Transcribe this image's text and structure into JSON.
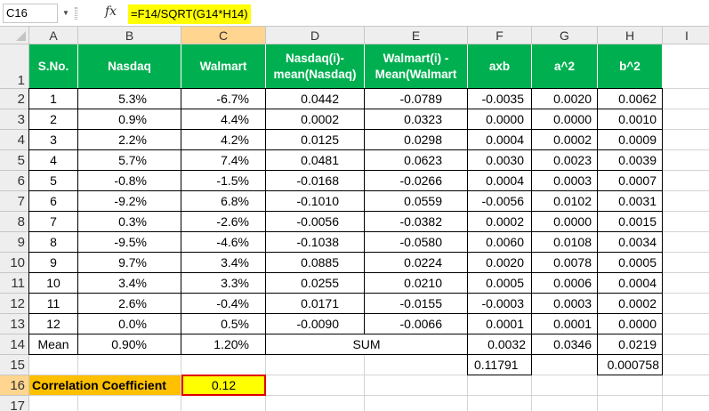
{
  "formula_bar": {
    "cell_ref": "C16",
    "fx_symbol": "fx",
    "formula": "=F14/SQRT(G14*H14)"
  },
  "columns": [
    "A",
    "B",
    "C",
    "D",
    "E",
    "F",
    "G",
    "H",
    "I"
  ],
  "selected_column": "C",
  "selected_row": "16",
  "row_numbers": [
    "1",
    "2",
    "3",
    "4",
    "5",
    "6",
    "7",
    "8",
    "9",
    "10",
    "11",
    "12",
    "13",
    "14",
    "15",
    "16",
    "17"
  ],
  "headers": [
    "S.No.",
    "Nasdaq",
    "Walmart",
    "Nasdaq(i)-mean(Nasdaq)",
    "Walmart(i) - Mean(Walmart",
    "axb",
    "a^2",
    "b^2"
  ],
  "rows": [
    [
      "1",
      "5.3%",
      "-6.7%",
      "0.0442",
      "-0.0789",
      "-0.0035",
      "0.0020",
      "0.0062"
    ],
    [
      "2",
      "0.9%",
      "4.4%",
      "0.0002",
      "0.0323",
      "0.0000",
      "0.0000",
      "0.0010"
    ],
    [
      "3",
      "2.2%",
      "4.2%",
      "0.0125",
      "0.0298",
      "0.0004",
      "0.0002",
      "0.0009"
    ],
    [
      "4",
      "5.7%",
      "7.4%",
      "0.0481",
      "0.0623",
      "0.0030",
      "0.0023",
      "0.0039"
    ],
    [
      "5",
      "-0.8%",
      "-1.5%",
      "-0.0168",
      "-0.0266",
      "0.0004",
      "0.0003",
      "0.0007"
    ],
    [
      "6",
      "-9.2%",
      "6.8%",
      "-0.1010",
      "0.0559",
      "-0.0056",
      "0.0102",
      "0.0031"
    ],
    [
      "7",
      "0.3%",
      "-2.6%",
      "-0.0056",
      "-0.0382",
      "0.0002",
      "0.0000",
      "0.0015"
    ],
    [
      "8",
      "-9.5%",
      "-4.6%",
      "-0.1038",
      "-0.0580",
      "0.0060",
      "0.0108",
      "0.0034"
    ],
    [
      "9",
      "9.7%",
      "3.4%",
      "0.0885",
      "0.0224",
      "0.0020",
      "0.0078",
      "0.0005"
    ],
    [
      "10",
      "3.4%",
      "3.3%",
      "0.0255",
      "0.0210",
      "0.0005",
      "0.0006",
      "0.0004"
    ],
    [
      "11",
      "2.6%",
      "-0.4%",
      "0.0171",
      "-0.0155",
      "-0.0003",
      "0.0003",
      "0.0002"
    ],
    [
      "12",
      "0.0%",
      "0.5%",
      "-0.0090",
      "-0.0066",
      "0.0001",
      "0.0001",
      "0.0000"
    ]
  ],
  "mean_row": {
    "label": "Mean",
    "nasdaq": "0.90%",
    "walmart": "1.20%",
    "sum_label": "SUM",
    "axb": "0.0032",
    "a2": "0.0346",
    "b2": "0.0219"
  },
  "row15": {
    "f": "0.11791",
    "h": "0.000758"
  },
  "correlation": {
    "label": "Correlation Coefficient",
    "value": "0.12"
  },
  "colors": {
    "header_green": "#00b050",
    "label_orange": "#ffc000",
    "highlight_yellow": "#ffff00",
    "selection_border": "#e00000"
  }
}
